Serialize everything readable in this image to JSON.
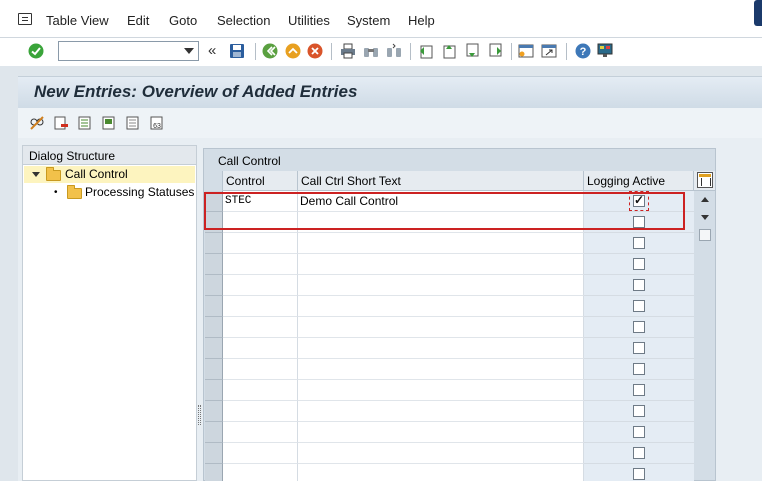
{
  "menubar": {
    "items": [
      "Table View",
      "Edit",
      "Goto",
      "Selection",
      "Utilities",
      "System",
      "Help"
    ]
  },
  "toolbar": {
    "command_value": "",
    "back_glyph": "«",
    "icons": [
      "enter-icon",
      "save-icon",
      "back-icon",
      "exit-icon",
      "cancel-icon",
      "print-icon",
      "find-icon",
      "find-next-icon",
      "first-page-icon",
      "previous-page-icon",
      "next-page-icon",
      "last-page-icon",
      "create-session-icon",
      "shortcut-icon",
      "help-icon",
      "layout-icon"
    ]
  },
  "title": "New Entries: Overview of Added Entries",
  "app_toolbar": {
    "icons": [
      "change-display-icon",
      "delete-icon",
      "select-all-icon",
      "select-block-icon",
      "deselect-all-icon",
      "where-used-icon"
    ]
  },
  "dialog_structure": {
    "header": "Dialog Structure",
    "items": [
      {
        "label": "Call Control",
        "level": 0,
        "expanded": true,
        "selected": true
      },
      {
        "label": "Processing Statuses",
        "level": 1,
        "expanded": false,
        "selected": false
      }
    ]
  },
  "table": {
    "caption": "Call Control",
    "columns": [
      "Control",
      "Call Ctrl Short Text",
      "Logging Active"
    ],
    "rows": [
      {
        "control": "STEC",
        "short_text": "Demo Call Control",
        "logging_active": true
      },
      {
        "control": "",
        "short_text": "",
        "logging_active": false
      },
      {
        "control": "",
        "short_text": "",
        "logging_active": false
      },
      {
        "control": "",
        "short_text": "",
        "logging_active": false
      },
      {
        "control": "",
        "short_text": "",
        "logging_active": false
      },
      {
        "control": "",
        "short_text": "",
        "logging_active": false
      },
      {
        "control": "",
        "short_text": "",
        "logging_active": false
      },
      {
        "control": "",
        "short_text": "",
        "logging_active": false
      },
      {
        "control": "",
        "short_text": "",
        "logging_active": false
      },
      {
        "control": "",
        "short_text": "",
        "logging_active": false
      },
      {
        "control": "",
        "short_text": "",
        "logging_active": false
      },
      {
        "control": "",
        "short_text": "",
        "logging_active": false
      },
      {
        "control": "",
        "short_text": "",
        "logging_active": false
      },
      {
        "control": "",
        "short_text": "",
        "logging_active": false
      }
    ]
  },
  "colors": {
    "highlight": "#cc2222",
    "title_bg": "#d8e2ec",
    "selected_tree_bg": "#fdf4bf"
  }
}
